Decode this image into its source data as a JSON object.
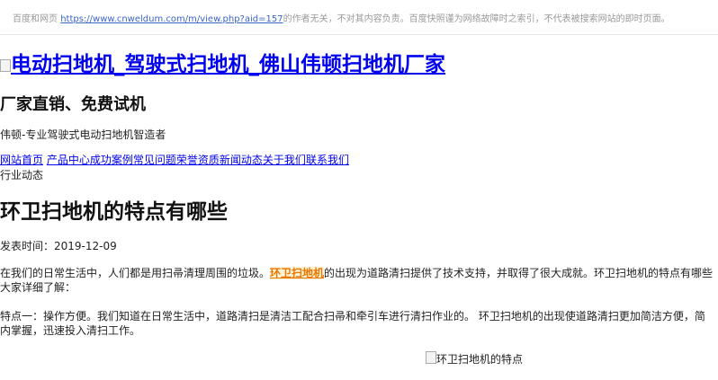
{
  "cache_notice": {
    "prefix": "百度和网页",
    "url": "https://www.cnweldum.com/m/view.php?aid=157",
    "suffix": "的作者无关，不对其内容负责。百度快照谨为网络故障时之索引，不代表被搜索网站的即时页面。"
  },
  "header": {
    "logo_alt": "电动扫地机_驾驶式扫地机_佛山伟顿扫地机厂家",
    "slogan": "厂家直销、免费试机",
    "tagline": "伟顿-专业驾驶式电动扫地机智造者"
  },
  "nav": {
    "items": [
      {
        "label": "网站首页"
      },
      {
        "label": "产品中心"
      },
      {
        "label": "成功案例"
      },
      {
        "label": "常见问题"
      },
      {
        "label": "荣誉资质"
      },
      {
        "label": "新闻动态"
      },
      {
        "label": "关于我们"
      },
      {
        "label": "联系我们"
      }
    ]
  },
  "breadcrumb": "行业动态",
  "article": {
    "title": "环卫扫地机的特点有哪些",
    "date": "发表时间：2019-12-09",
    "p1_before": "在我们的日常生活中，人们都是用扫帚清理周围的垃圾。",
    "p1_keyword": "环卫扫地机",
    "p1_after": "的出现为道路清扫提供了技术支持，并取得了很大成就。环卫扫地机的特点有哪些",
    "p1_line2": "大家详细了解：",
    "p2_line1": "特点一：操作方便。我们知道在日常生活中，道路清扫是清洁工配合扫帚和牵引车进行清扫作业的。 环卫扫地机的出现使道路清扫更加简洁方便，简",
    "p2_line2": "内掌握，迅速投入清扫工作。",
    "image_alt": "环卫扫地机的特点"
  }
}
